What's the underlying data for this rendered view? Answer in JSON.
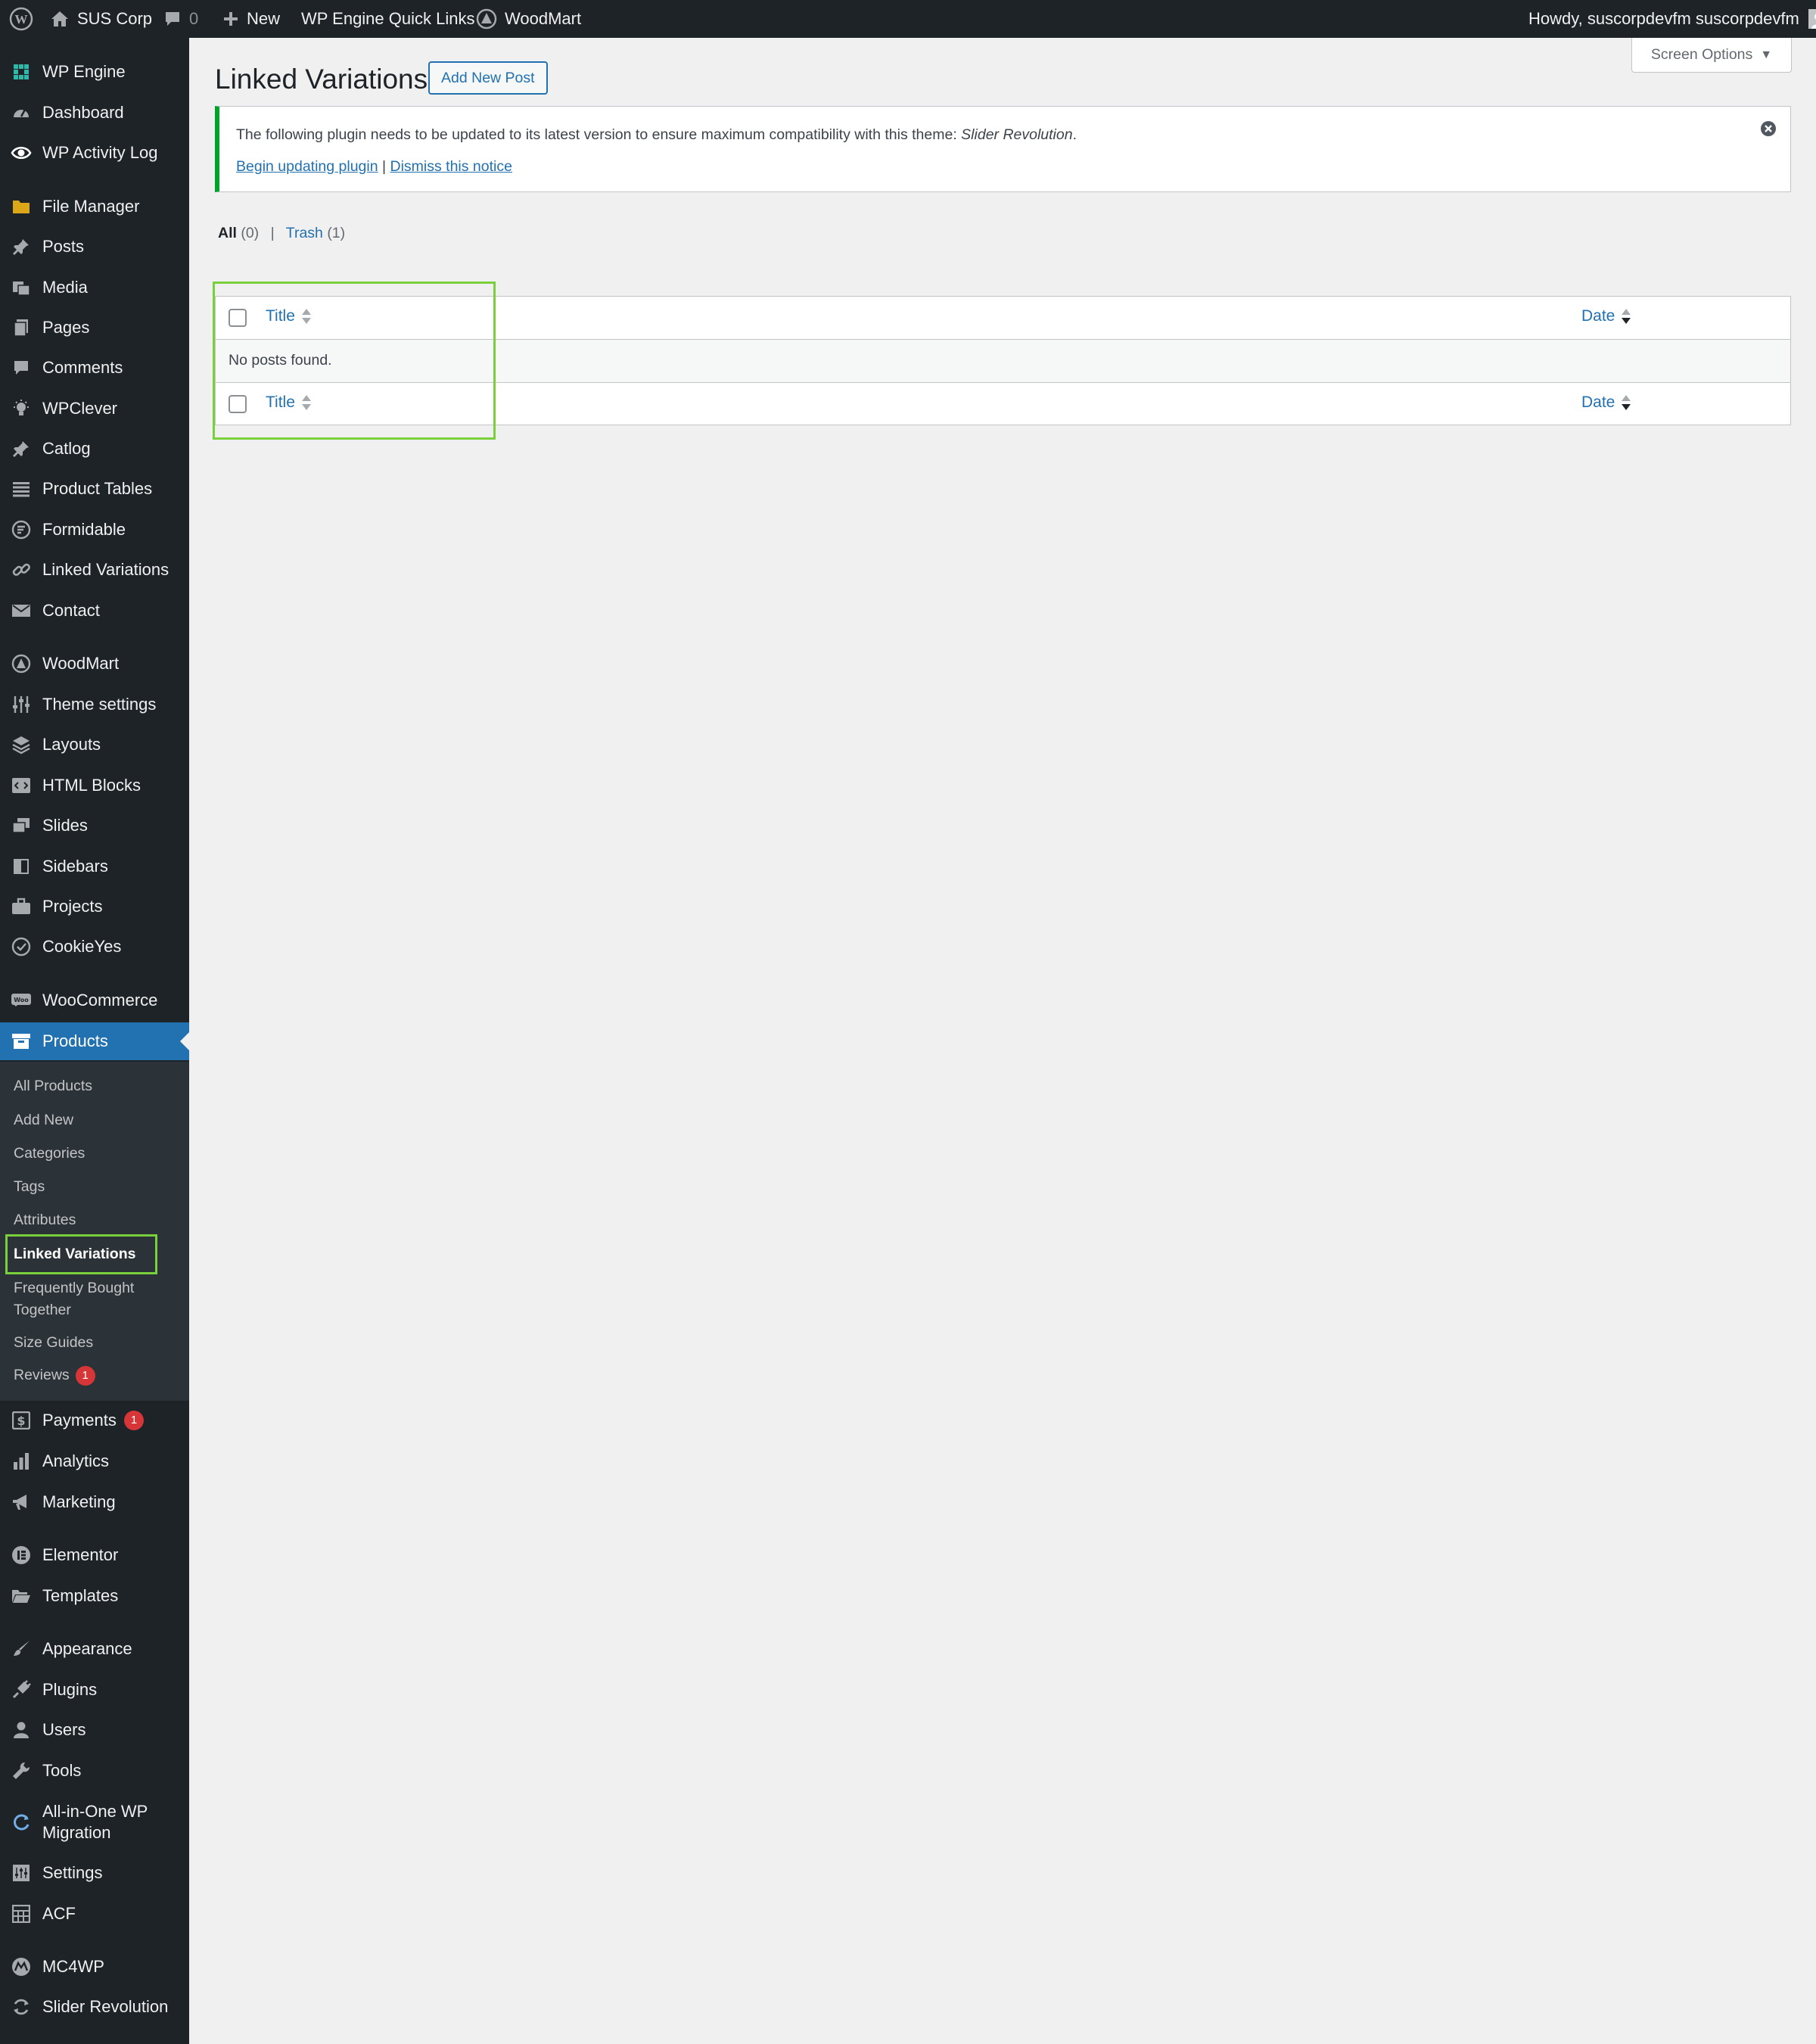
{
  "admin_bar": {
    "site_name": "SUS Corp",
    "comments_count": "0",
    "new_label": "New",
    "quick_links_label": "WP Engine Quick Links",
    "woodmart_label": "WoodMart",
    "howdy_text": "Howdy, suscorpdevfm suscorpdevfm"
  },
  "sidebar": {
    "items": [
      {
        "id": "wp-engine",
        "label": "WP Engine",
        "icon": "grid-icon"
      },
      {
        "id": "dashboard",
        "label": "Dashboard",
        "icon": "gauge-icon"
      },
      {
        "id": "wp-activity-log",
        "label": "WP Activity Log",
        "icon": "eye-icon"
      },
      {
        "id": "file-manager",
        "label": "File Manager",
        "icon": "folder-icon"
      },
      {
        "id": "posts",
        "label": "Posts",
        "icon": "pushpin-icon"
      },
      {
        "id": "media",
        "label": "Media",
        "icon": "media-icon"
      },
      {
        "id": "pages",
        "label": "Pages",
        "icon": "pages-icon"
      },
      {
        "id": "comments",
        "label": "Comments",
        "icon": "comment-icon"
      },
      {
        "id": "wpclever",
        "label": "WPClever",
        "icon": "lightbulb-icon"
      },
      {
        "id": "catlog",
        "label": "Catlog",
        "icon": "pushpin-icon"
      },
      {
        "id": "product-tables",
        "label": "Product Tables",
        "icon": "list-icon"
      },
      {
        "id": "formidable",
        "label": "Formidable",
        "icon": "formidable-icon"
      },
      {
        "id": "linked-variations",
        "label": "Linked Variations",
        "icon": "link-icon"
      },
      {
        "id": "contact",
        "label": "Contact",
        "icon": "envelope-icon"
      },
      {
        "id": "woodmart",
        "label": "WoodMart",
        "icon": "woodmart-icon"
      },
      {
        "id": "theme-settings",
        "label": "Theme settings",
        "icon": "sliders-icon"
      },
      {
        "id": "layouts",
        "label": "Layouts",
        "icon": "layers-icon"
      },
      {
        "id": "html-blocks",
        "label": "HTML Blocks",
        "icon": "code-icon"
      },
      {
        "id": "slides",
        "label": "Slides",
        "icon": "slides-icon"
      },
      {
        "id": "sidebars",
        "label": "Sidebars",
        "icon": "sidebar-icon"
      },
      {
        "id": "projects",
        "label": "Projects",
        "icon": "briefcase-icon"
      },
      {
        "id": "cookieyes",
        "label": "CookieYes",
        "icon": "cookie-icon"
      },
      {
        "id": "woocommerce",
        "label": "WooCommerce",
        "icon": "woo-icon"
      },
      {
        "id": "products",
        "label": "Products",
        "icon": "archive-icon"
      },
      {
        "id": "payments",
        "label": "Payments",
        "icon": "dollar-icon",
        "badge": "1"
      },
      {
        "id": "analytics",
        "label": "Analytics",
        "icon": "bar-chart-icon"
      },
      {
        "id": "marketing",
        "label": "Marketing",
        "icon": "megaphone-icon"
      },
      {
        "id": "elementor",
        "label": "Elementor",
        "icon": "elementor-icon"
      },
      {
        "id": "templates",
        "label": "Templates",
        "icon": "folder-open-icon"
      },
      {
        "id": "appearance",
        "label": "Appearance",
        "icon": "brush-icon"
      },
      {
        "id": "plugins",
        "label": "Plugins",
        "icon": "plug-icon"
      },
      {
        "id": "users",
        "label": "Users",
        "icon": "user-icon"
      },
      {
        "id": "tools",
        "label": "Tools",
        "icon": "wrench-icon"
      },
      {
        "id": "all-in-one-wp-migration",
        "label": "All-in-One WP Migration",
        "icon": "migration-icon"
      },
      {
        "id": "settings",
        "label": "Settings",
        "icon": "settings-icon"
      },
      {
        "id": "acf",
        "label": "ACF",
        "icon": "table-icon"
      },
      {
        "id": "mc4wp",
        "label": "MC4WP",
        "icon": "mc4wp-icon"
      },
      {
        "id": "slider-revolution",
        "label": "Slider Revolution",
        "icon": "refresh-icon"
      }
    ],
    "submenu": [
      {
        "id": "all-products",
        "label": "All Products"
      },
      {
        "id": "add-new",
        "label": "Add New"
      },
      {
        "id": "categories",
        "label": "Categories"
      },
      {
        "id": "tags",
        "label": "Tags"
      },
      {
        "id": "attributes",
        "label": "Attributes"
      },
      {
        "id": "linked-variations",
        "label": "Linked Variations",
        "current": true
      },
      {
        "id": "frequently-bought-together",
        "label": "Frequently Bought Together"
      },
      {
        "id": "size-guides",
        "label": "Size Guides"
      },
      {
        "id": "reviews",
        "label": "Reviews",
        "badge": "1"
      }
    ]
  },
  "page": {
    "title": "Linked Variations",
    "add_new_label": "Add New Post",
    "screen_options_label": "Screen Options"
  },
  "notice": {
    "message_prefix": "The following plugin needs to be updated to its latest version to ensure maximum compatibility with this theme: ",
    "plugin_name": "Slider Revolution",
    "message_suffix": ".",
    "begin_update_label": "Begin updating plugin",
    "separator": "|",
    "dismiss_label": "Dismiss this notice"
  },
  "views": {
    "all_label": "All",
    "all_count": "(0)",
    "separator": "|",
    "trash_label": "Trash",
    "trash_count": "(1)"
  },
  "table": {
    "col_title": "Title",
    "col_date": "Date",
    "empty_message": "No posts found."
  },
  "colors": {
    "accent": "#2271b1",
    "sidebar_bg": "#1d2327",
    "notice_green": "#00a32a",
    "badge_red": "#d63638",
    "highlight_green": "#7ad03a"
  }
}
